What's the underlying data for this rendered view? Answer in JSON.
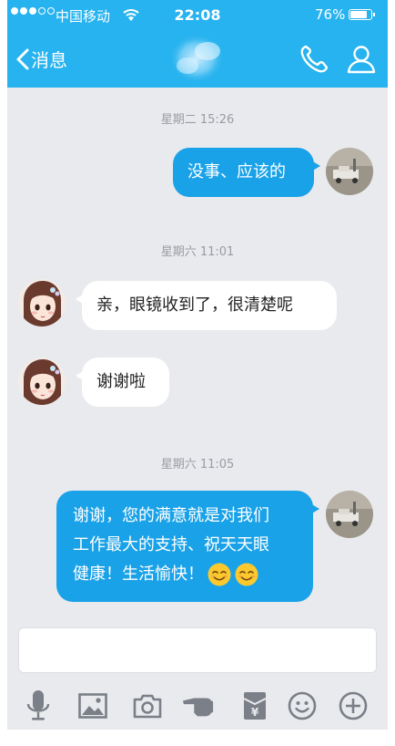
{
  "status_bar": {
    "carrier": "中国移动",
    "time": "22:08",
    "battery": "76%"
  },
  "header": {
    "back_label": "消息"
  },
  "messages": [
    {
      "timestamp": "星期二 15:26"
    },
    {
      "text": "没事、应该的"
    },
    {
      "timestamp": "星期六 11:01"
    },
    {
      "text": "亲，眼镜收到了，很清楚呢"
    },
    {
      "text": "谢谢啦"
    },
    {
      "timestamp": "星期六 11:05"
    },
    {
      "line1": "谢谢，您的满意就是对我们",
      "line2": "工作最大的支持、祝天天眼",
      "line3": "健康！生活愉快！"
    }
  ],
  "input": {
    "placeholder": ""
  },
  "toolbar": [
    "microphone-icon",
    "image-icon",
    "camera-icon",
    "poke-icon",
    "red-packet-icon",
    "emoji-icon",
    "plus-icon"
  ],
  "colors": {
    "header": "#27b3ef",
    "outgoing_bubble": "#1aa2e8",
    "incoming_bubble": "#ffffff",
    "background": "#e9eaee"
  }
}
